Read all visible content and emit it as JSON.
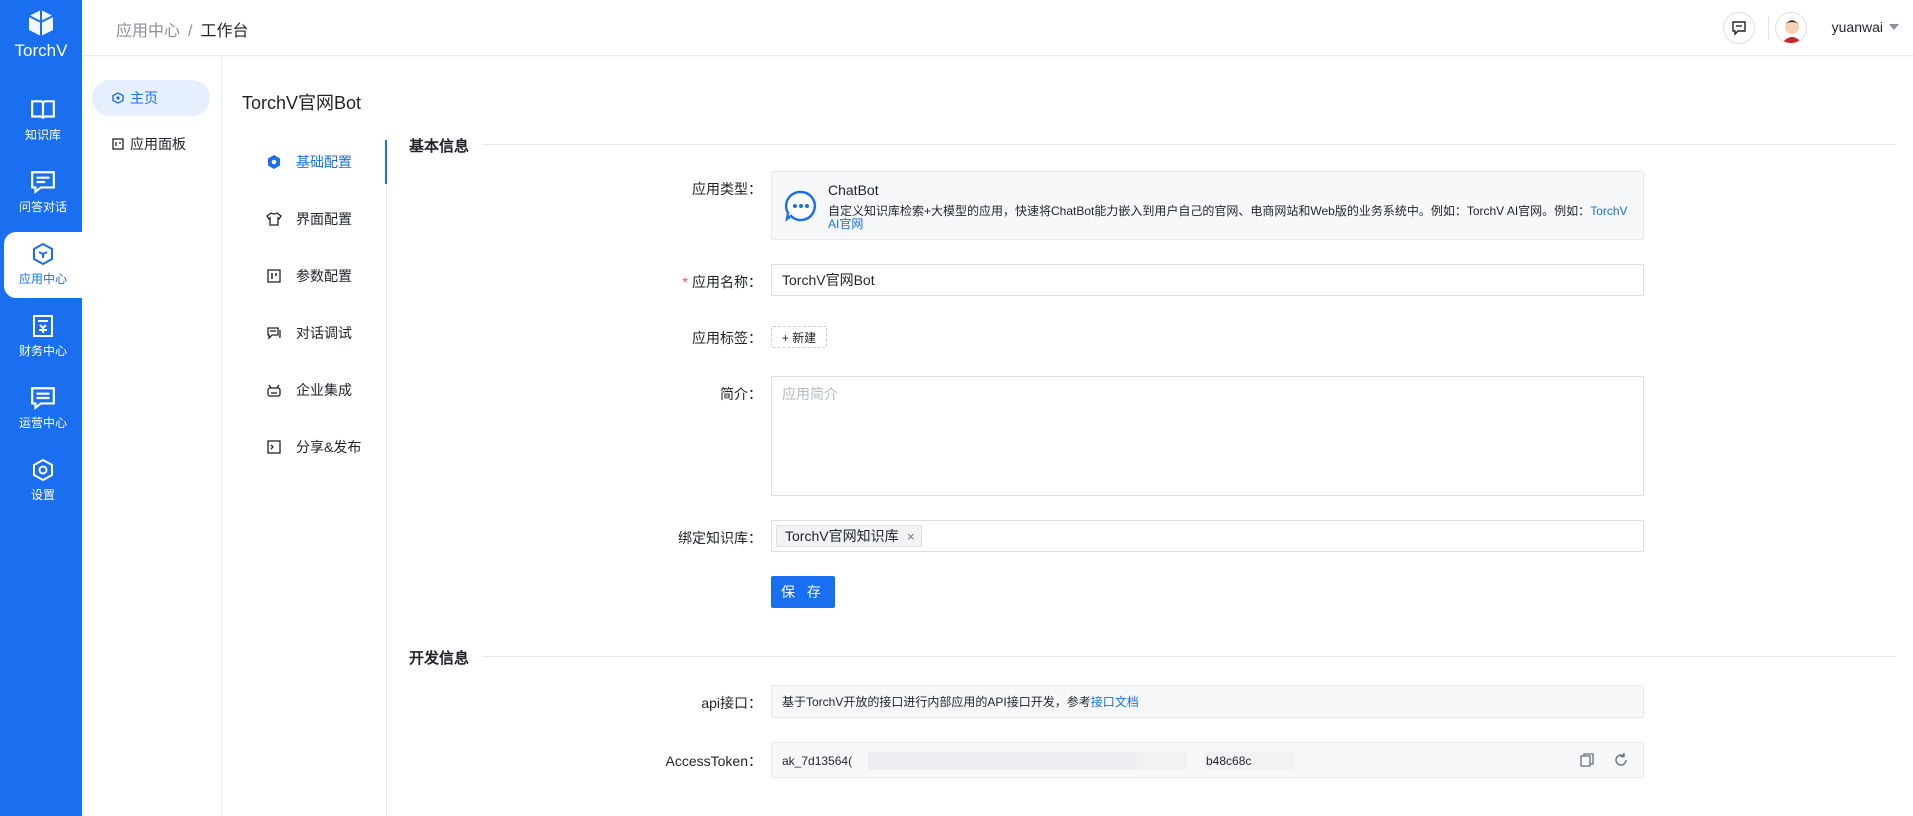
{
  "brand": {
    "name": "TorchV",
    "accent": "#1a6ff0"
  },
  "rail": {
    "items": [
      {
        "label": "知识库",
        "icon": "book-icon"
      },
      {
        "label": "问答对话",
        "icon": "chat-icon"
      },
      {
        "label": "应用中心",
        "icon": "app-center-icon",
        "active": true
      },
      {
        "label": "财务中心",
        "icon": "finance-icon"
      },
      {
        "label": "运营中心",
        "icon": "operations-icon"
      },
      {
        "label": "设置",
        "icon": "settings-icon"
      }
    ]
  },
  "header": {
    "breadcrumb": [
      "应用中心",
      "工作台"
    ],
    "separator": "/",
    "username": "yuanwai"
  },
  "side_nav": {
    "items": [
      {
        "label": "主页",
        "icon": "home-icon",
        "active": true
      },
      {
        "label": "应用面板",
        "icon": "panel-icon"
      }
    ]
  },
  "app_title": "TorchV官网Bot",
  "config_nav": {
    "items": [
      {
        "label": "基础配置",
        "icon": "settings-gear-icon",
        "active": true
      },
      {
        "label": "界面配置",
        "icon": "shirt-icon"
      },
      {
        "label": "参数配置",
        "icon": "sliders-icon"
      },
      {
        "label": "对话调试",
        "icon": "debug-chat-icon"
      },
      {
        "label": "企业集成",
        "icon": "integration-icon"
      },
      {
        "label": "分享&发布",
        "icon": "share-icon"
      }
    ]
  },
  "basic_info": {
    "section_title": "基本信息",
    "app_type": {
      "label": "应用类型",
      "name": "ChatBot",
      "description": "自定义知识库检索+大模型的应用，快速将ChatBot能力嵌入到用户自己的官网、电商网站和Web版的业务系统中。例如：TorchV AI官网。例如：",
      "link_text": "TorchV AI官网"
    },
    "app_name": {
      "label": "应用名称",
      "value": "TorchV官网Bot"
    },
    "app_tags": {
      "label": "应用标签",
      "new_label": "+ 新建"
    },
    "intro": {
      "label": "简介",
      "placeholder": "应用简介"
    },
    "kb": {
      "label": "绑定知识库",
      "tag": "TorchV官网知识库"
    },
    "save_label": "保 存"
  },
  "dev_info": {
    "section_title": "开发信息",
    "api": {
      "label": "api接口",
      "text": "基于TorchV开放的接口进行内部应用的API接口开发，参考",
      "link_text": "接口文档"
    },
    "token": {
      "label": "AccessToken",
      "prefix": "ak_7d13564(",
      "suffix": "b48c68c"
    }
  }
}
